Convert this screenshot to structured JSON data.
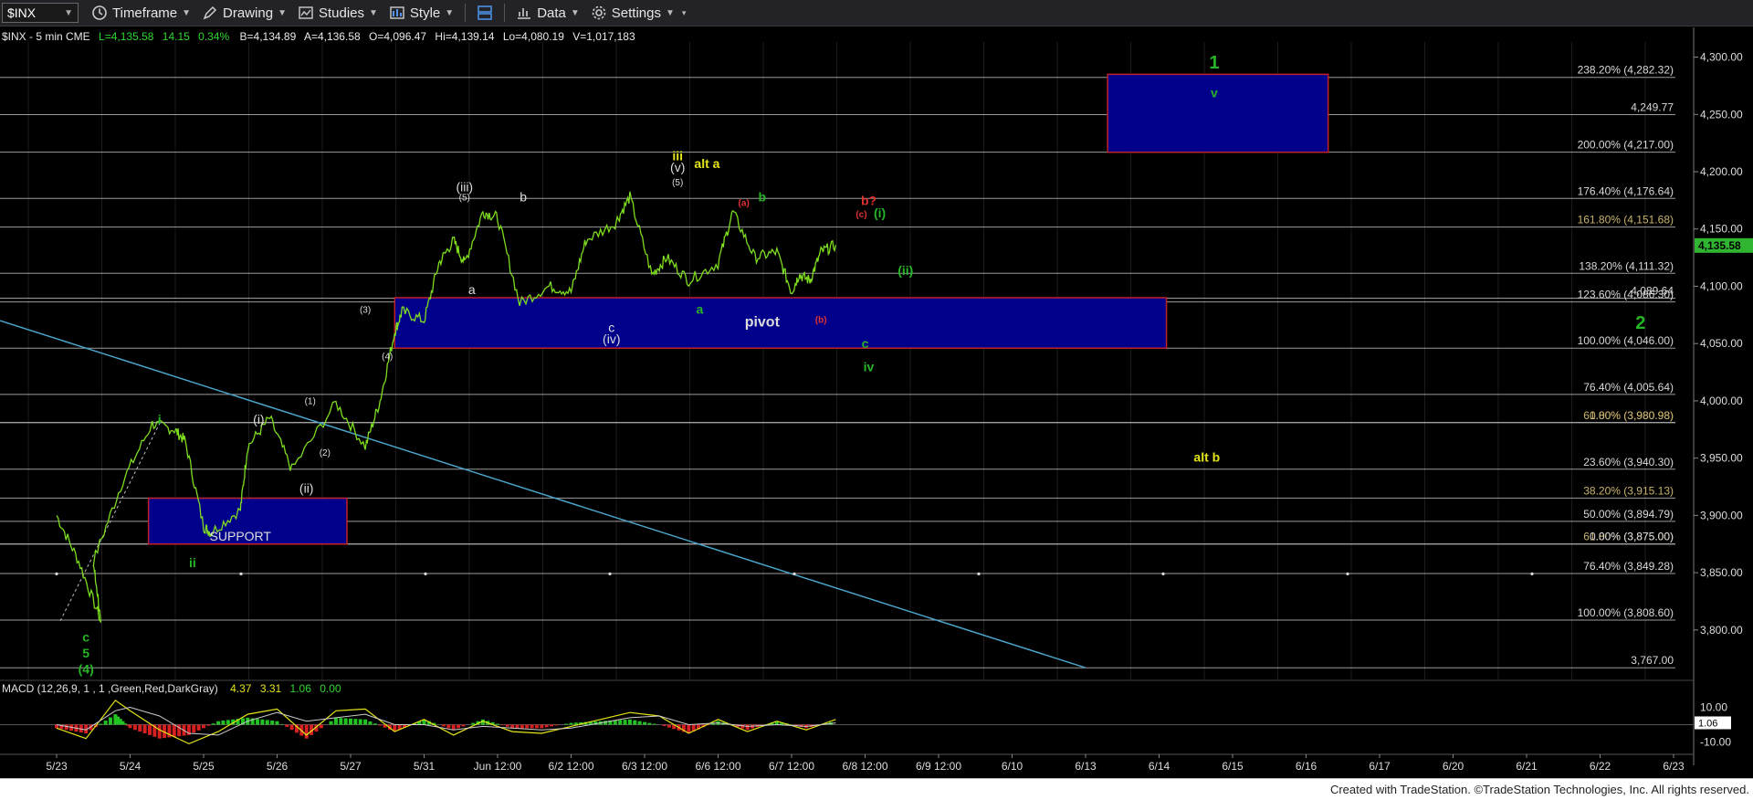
{
  "toolbar": {
    "symbol": "$INX",
    "timeframe": "Timeframe",
    "drawing": "Drawing",
    "studies": "Studies",
    "style": "Style",
    "data": "Data",
    "settings": "Settings"
  },
  "chart_header": {
    "name": "$INX - 5 min  CME",
    "last": "L=4,135.58",
    "change": "14.15",
    "pct": "0.34%",
    "bid": "B=4,134.89",
    "ask": "A=4,136.58",
    "open": "O=4,096.47",
    "high": "Hi=4,139.14",
    "low": "Lo=4,080.19",
    "volume": "V=1,017,183"
  },
  "macd_header": {
    "name": "MACD (12,26,9, 1 , 1 ,Green,Red,DarkGray)",
    "v1": "4.37",
    "v2": "3.31",
    "v3": "1.06",
    "v4": "0.00"
  },
  "colors": {
    "background": "#000000",
    "price_line": "#7ddc1f",
    "box_fill": "#00008b",
    "box_border": "#c0202a",
    "wave_green": "#26b526",
    "wave_yellow": "#e4e41a",
    "fib_text": "#d9d9d9",
    "fib_text_gold": "#c8b26a",
    "trendline": "#4aa3c8"
  },
  "chart_data": {
    "type": "line",
    "title": "$INX - 5 min",
    "x_ticks": [
      "5/23",
      "5/24",
      "5/25",
      "5/26",
      "5/27",
      "5/31",
      "Jun 12:00",
      "6/2 12:00",
      "6/3 12:00",
      "6/6 12:00",
      "6/7 12:00",
      "6/8 12:00",
      "6/9 12:00",
      "6/10",
      "6/13",
      "6/14",
      "6/15",
      "6/16",
      "6/17",
      "6/20",
      "6/21",
      "6/22",
      "6/23"
    ],
    "ylim": [
      3760,
      4310
    ],
    "y_ticks": [
      3800,
      3850,
      3900,
      3950,
      4000,
      4050,
      4100,
      4150,
      4200,
      4250,
      4300
    ],
    "y_tick_labels": [
      "3,800.00",
      "3,850.00",
      "3,900.00",
      "3,950.00",
      "4,000.00",
      "4,050.00",
      "4,100.00",
      "4,150.00",
      "4,200.00",
      "4,250.00",
      "4,300.00"
    ],
    "last_value": 4135.58,
    "last_label": "4,135.58",
    "price_series_x": [
      0,
      0.3,
      0.6,
      0.5,
      0.9,
      1.3,
      1.6,
      1.75,
      2.0,
      2.1,
      2.5,
      2.6,
      2.9,
      3.2,
      3.8,
      4.2,
      4.4,
      4.6,
      4.7,
      5.0,
      5.2,
      5.4,
      5.55,
      5.8,
      6.0,
      6.3,
      6.7,
      7.0,
      7.2,
      7.6,
      7.8,
      8.1,
      8.3,
      8.6,
      9.0,
      9.2,
      9.5,
      9.8,
      10.0,
      10.1,
      10.25,
      10.4,
      10.6
    ],
    "price_series_y": [
      3900,
      3860,
      3808,
      3860,
      3930,
      3980,
      3975,
      3965,
      3890,
      3885,
      3905,
      3960,
      3985,
      3940,
      3998,
      3960,
      4000,
      4060,
      4078,
      4070,
      4120,
      4140,
      4120,
      4165,
      4160,
      4085,
      4100,
      4095,
      4140,
      4155,
      4178,
      4110,
      4125,
      4105,
      4120,
      4165,
      4125,
      4130,
      4095,
      4110,
      4105,
      4130,
      4136
    ],
    "fib_levels": [
      {
        "label": "238.20% (4,282.32)",
        "value": 4282.32
      },
      {
        "label": "4,249.77",
        "value": 4249.77
      },
      {
        "label": "200.00% (4,217.00)",
        "value": 4217.0
      },
      {
        "label": "176.40% (4,176.64)",
        "value": 4176.64
      },
      {
        "label": "161.80% (4,151.68)",
        "value": 4151.68,
        "gold": true
      },
      {
        "label": "138.20% (4,111.32)",
        "value": 4111.32
      },
      {
        "label": "4,089.64",
        "value": 4089.64
      },
      {
        "label": "123.60% (4,086.30)",
        "value": 4086.3
      },
      {
        "label": "100.00% (4,046.00)",
        "value": 4046.0
      },
      {
        "label": "76.40% (4,005.64)",
        "value": 4005.64
      },
      {
        "label": "61.80% (3,980.98)",
        "value": 3980.98,
        "gold": true
      },
      {
        "label": "0.00% (3,980.98)",
        "value": 3980.98,
        "gold": true
      },
      {
        "label": "23.60% (3,940.30)",
        "value": 3940.3
      },
      {
        "label": "38.20% (3,915.13)",
        "value": 3915.13,
        "gold": true
      },
      {
        "label": "50.00% (3,894.79)",
        "value": 3894.79
      },
      {
        "label": "61.80% (3,875.00)",
        "value": 3875.0,
        "gold": true
      },
      {
        "label": "0.00% (3,875.00)",
        "value": 3875.0
      },
      {
        "label": "76.40% (3,849.28)",
        "value": 3849.28
      },
      {
        "label": "100.00% (3,808.60)",
        "value": 3808.6
      },
      {
        "label": "3,767.00",
        "value": 3767.0
      }
    ],
    "boxes": [
      {
        "label": "",
        "x0": 14.3,
        "x1": 17.3,
        "y0": 4217,
        "y1": 4285
      },
      {
        "label": "pivot",
        "x0": 4.6,
        "x1": 15.1,
        "y0": 4046,
        "y1": 4090
      },
      {
        "label": "SUPPORT",
        "x0": 1.25,
        "x1": 3.95,
        "y0": 3875,
        "y1": 3915
      }
    ],
    "annotations": [
      {
        "text": "1",
        "x": 15.75,
        "y": 4290,
        "color": "green",
        "size": "big"
      },
      {
        "text": "v",
        "x": 15.75,
        "y": 4265,
        "color": "green"
      },
      {
        "text": "2",
        "x": 21.55,
        "y": 4063,
        "color": "green",
        "size": "big"
      },
      {
        "text": "alt b",
        "x": 15.65,
        "y": 3947,
        "color": "yellow"
      },
      {
        "text": "alt a",
        "x": 8.85,
        "y": 4203,
        "color": "yellow"
      },
      {
        "text": "iii",
        "x": 8.45,
        "y": 4210,
        "color": "yellow"
      },
      {
        "text": "(v)",
        "x": 8.45,
        "y": 4200,
        "color": "white"
      },
      {
        "text": "(5)",
        "x": 8.45,
        "y": 4188,
        "color": "white",
        "size": "small"
      },
      {
        "text": "(iii)",
        "x": 5.55,
        "y": 4183,
        "color": "white"
      },
      {
        "text": "(5)",
        "x": 5.55,
        "y": 4175,
        "color": "white",
        "size": "small"
      },
      {
        "text": "b",
        "x": 6.35,
        "y": 4174,
        "color": "white"
      },
      {
        "text": "a",
        "x": 5.65,
        "y": 4093,
        "color": "white"
      },
      {
        "text": "c",
        "x": 7.55,
        "y": 4060,
        "color": "white"
      },
      {
        "text": "(iv)",
        "x": 7.55,
        "y": 4050,
        "color": "white"
      },
      {
        "text": "(3)",
        "x": 4.2,
        "y": 4077,
        "color": "white",
        "size": "small"
      },
      {
        "text": "(4)",
        "x": 4.5,
        "y": 4036,
        "color": "white",
        "size": "small"
      },
      {
        "text": "(1)",
        "x": 3.45,
        "y": 3997,
        "color": "white",
        "size": "small"
      },
      {
        "text": "(2)",
        "x": 3.65,
        "y": 3952,
        "color": "white",
        "size": "small"
      },
      {
        "text": "(i)",
        "x": 2.75,
        "y": 3980,
        "color": "white"
      },
      {
        "text": "(ii)",
        "x": 3.4,
        "y": 3920,
        "color": "white"
      },
      {
        "text": "i",
        "x": 1.4,
        "y": 3980,
        "color": "green"
      },
      {
        "text": "ii",
        "x": 1.85,
        "y": 3855,
        "color": "green"
      },
      {
        "text": "SUPPORT",
        "x": 2.5,
        "y": 3878,
        "color": "white"
      },
      {
        "text": "c",
        "x": 0.4,
        "y": 3790,
        "color": "green"
      },
      {
        "text": "5",
        "x": 0.4,
        "y": 3776,
        "color": "green"
      },
      {
        "text": "(4)",
        "x": 0.4,
        "y": 3762,
        "color": "green"
      },
      {
        "text": "a",
        "x": 8.75,
        "y": 4076,
        "color": "green"
      },
      {
        "text": "b",
        "x": 9.6,
        "y": 4174,
        "color": "green"
      },
      {
        "text": "(a)",
        "x": 9.35,
        "y": 4170,
        "color": "red",
        "size": "small"
      },
      {
        "text": "(b)",
        "x": 10.4,
        "y": 4068,
        "color": "red",
        "size": "small"
      },
      {
        "text": "b?",
        "x": 11.05,
        "y": 4171,
        "color": "red"
      },
      {
        "text": "(c)",
        "x": 10.95,
        "y": 4160,
        "color": "red",
        "size": "small"
      },
      {
        "text": "(i)",
        "x": 11.2,
        "y": 4160,
        "color": "green"
      },
      {
        "text": "(ii)",
        "x": 11.55,
        "y": 4110,
        "color": "green"
      },
      {
        "text": "pivot",
        "x": 9.6,
        "y": 4065,
        "color": "white",
        "size": "mid"
      },
      {
        "text": "c",
        "x": 11.0,
        "y": 4046,
        "color": "green"
      },
      {
        "text": "iv",
        "x": 11.05,
        "y": 4026,
        "color": "green"
      }
    ],
    "macd": {
      "ylim": [
        -15,
        15
      ],
      "tick_labels": [
        "10.00",
        "-10.00"
      ],
      "tick_values": [
        10,
        -10
      ],
      "last_label": "1.06",
      "last_value": 1.06,
      "x": [
        0,
        0.4,
        0.8,
        1.0,
        1.4,
        1.8,
        2.2,
        2.6,
        3.0,
        3.4,
        3.8,
        4.2,
        4.6,
        5.0,
        5.4,
        5.8,
        6.2,
        6.6,
        7.0,
        7.4,
        7.8,
        8.2,
        8.6,
        9.0,
        9.4,
        9.8,
        10.2,
        10.6
      ],
      "line": [
        -2,
        -8,
        14,
        8,
        -3,
        -11,
        -4,
        6,
        9,
        -6,
        8,
        9,
        -4,
        3,
        -6,
        2,
        -4,
        -5,
        -1,
        3,
        7,
        5,
        -5,
        3,
        -4,
        2,
        -3,
        3
      ],
      "signal": [
        0,
        -3,
        8,
        10,
        5,
        -5,
        -6,
        2,
        7,
        2,
        4,
        6,
        0,
        0,
        -3,
        -1,
        -2,
        -3,
        -2,
        1,
        4,
        5,
        0,
        1,
        -1,
        0,
        -1,
        1
      ]
    }
  }
}
